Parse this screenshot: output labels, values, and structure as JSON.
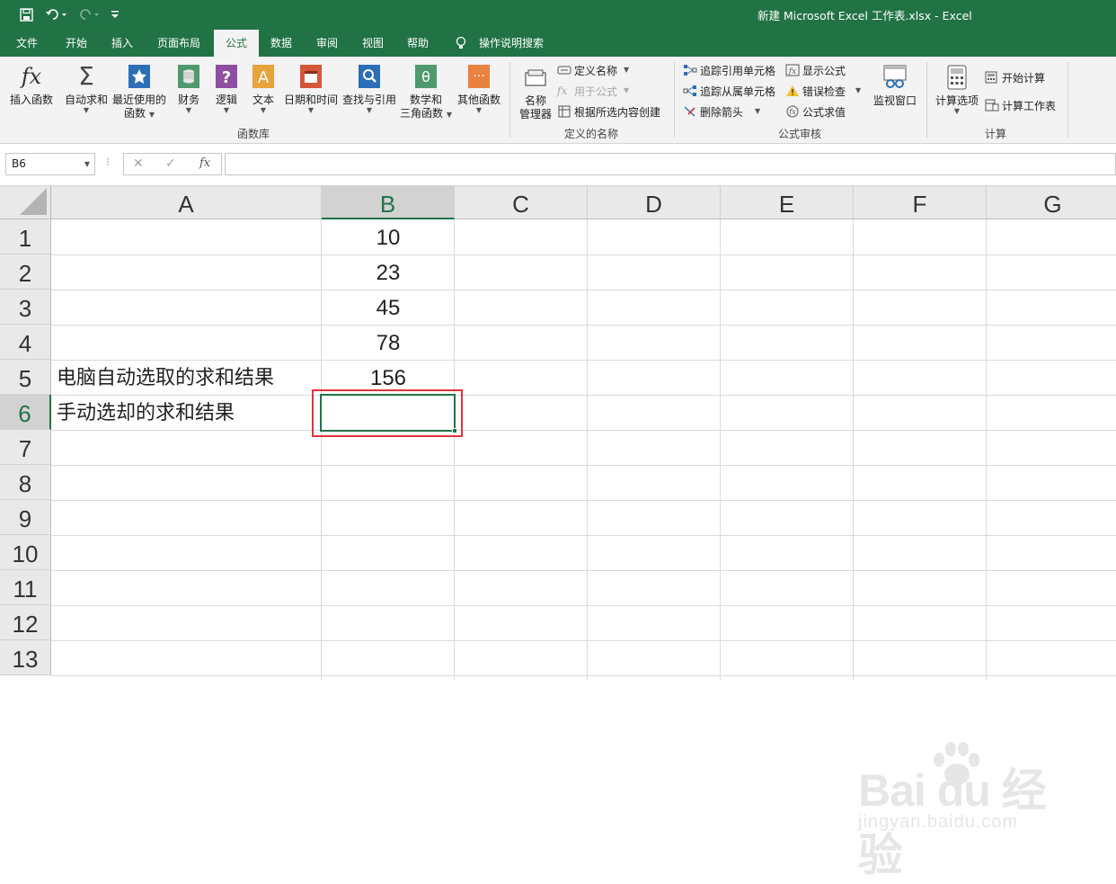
{
  "window": {
    "title": "新建 Microsoft Excel 工作表.xlsx  -  Excel"
  },
  "tabs": [
    {
      "label": "文件"
    },
    {
      "label": "开始"
    },
    {
      "label": "插入"
    },
    {
      "label": "页面布局"
    },
    {
      "label": "公式",
      "active": true
    },
    {
      "label": "数据"
    },
    {
      "label": "审阅"
    },
    {
      "label": "视图"
    },
    {
      "label": "帮助"
    },
    {
      "label": "操作说明搜索"
    }
  ],
  "ribbon": {
    "function_library": {
      "group_label": "函数库",
      "insert_function": "插入函数",
      "autosum": "自动求和",
      "recent_1": "最近使用的",
      "recent_2": "函数",
      "financial": "财务",
      "logical": "逻辑",
      "text": "文本",
      "datetime": "日期和时间",
      "lookup": "查找与引用",
      "math_1": "数学和",
      "math_2": "三角函数",
      "more": "其他函数"
    },
    "defined_names": {
      "group_label": "定义的名称",
      "name_manager_1": "名称",
      "name_manager_2": "管理器",
      "define_name": "定义名称",
      "use_in_formula": "用于公式",
      "create_from_selection": "根据所选内容创建"
    },
    "formula_auditing": {
      "group_label": "公式审核",
      "trace_precedents": "追踪引用单元格",
      "trace_dependents": "追踪从属单元格",
      "remove_arrows": "删除箭头",
      "show_formulas": "显示公式",
      "error_checking": "错误检查",
      "evaluate_formula": "公式求值",
      "watch_window": "监视窗口"
    },
    "calculation": {
      "group_label": "计算",
      "calc_options": "计算选项",
      "calc_now": "开始计算",
      "calc_sheet": "计算工作表"
    }
  },
  "formula_bar": {
    "name_box": "B6",
    "formula": ""
  },
  "grid": {
    "columns": [
      "A",
      "B",
      "C",
      "D",
      "E",
      "F",
      "G"
    ],
    "rows": [
      "1",
      "2",
      "3",
      "4",
      "5",
      "6",
      "7",
      "8",
      "9",
      "10",
      "11",
      "12",
      "13"
    ],
    "selected_column": "B",
    "selected_row": "6",
    "cells": {
      "B1": "10",
      "B2": "23",
      "B3": "45",
      "B4": "78",
      "B5": "156",
      "A5": "电脑自动选取的求和结果",
      "A6": "手动选却的求和结果"
    }
  },
  "watermark": {
    "brand": "Bai du 经验",
    "url": "jingyan.baidu.com"
  }
}
